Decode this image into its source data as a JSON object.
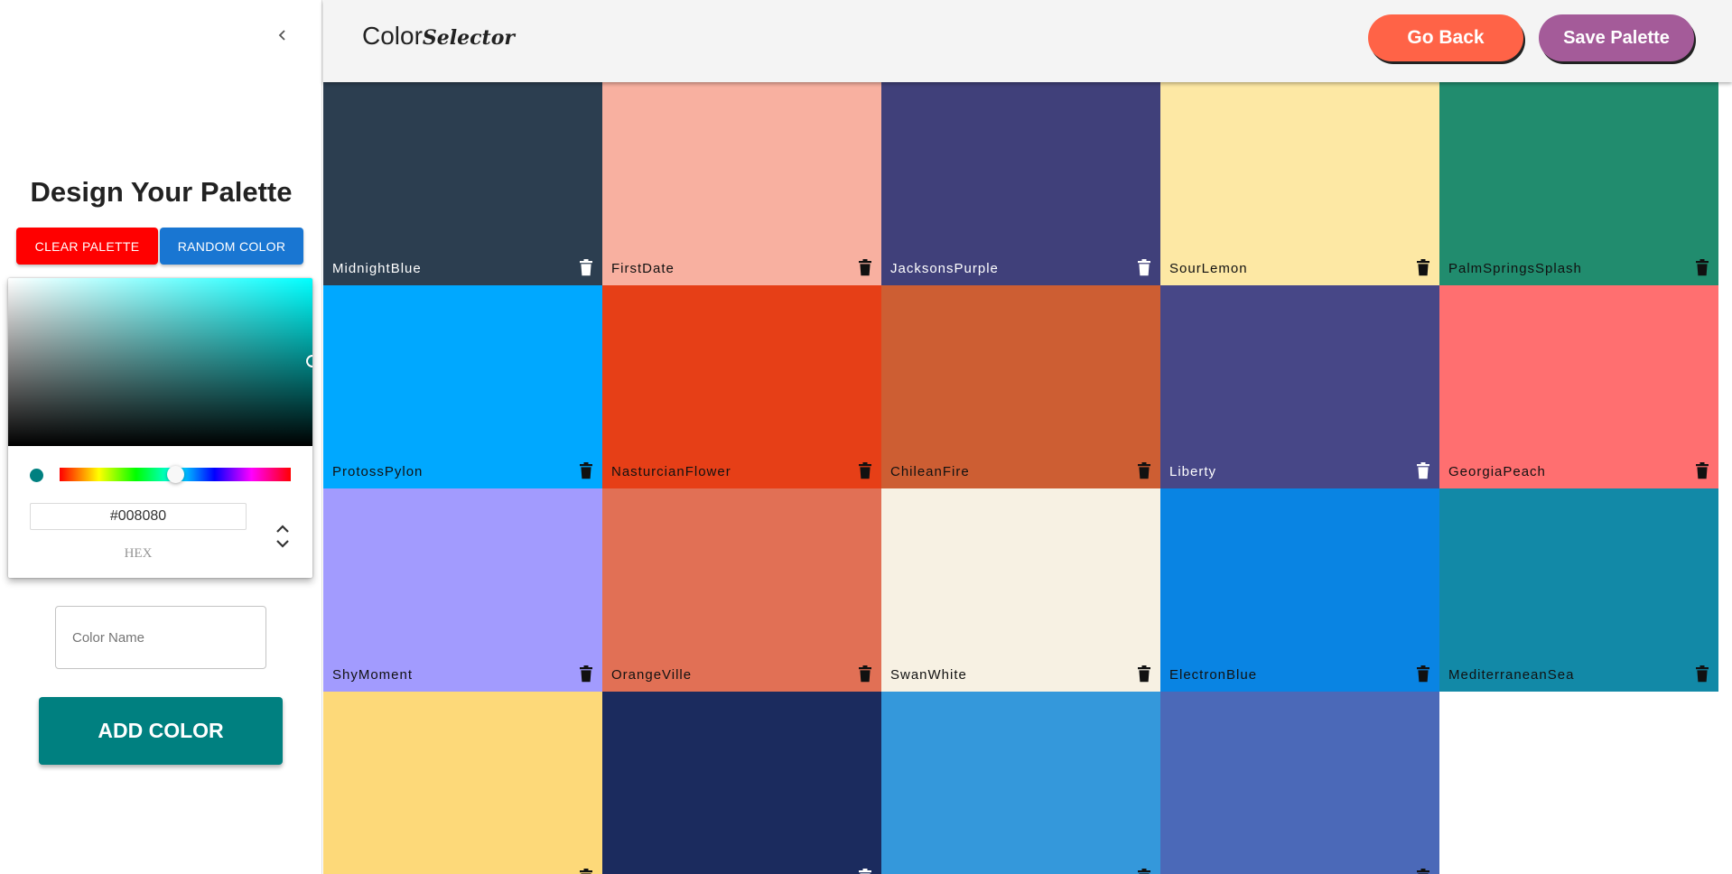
{
  "sidebar": {
    "title": "Design Your Palette",
    "clear_label": "CLEAR PALETTE",
    "random_label": "RANDOM COLOR",
    "picker": {
      "current_color": "#008080",
      "hex_value": "#008080",
      "mode_label": "HEX",
      "hue_color": "#00ffff"
    },
    "name_placeholder": "Color Name",
    "add_label": "ADD COLOR",
    "add_color": "#008080"
  },
  "header": {
    "logo_a": "Color",
    "logo_b": "Selector",
    "back_label": "Go Back",
    "save_label": "Save Palette"
  },
  "palette": [
    {
      "name": "MidnightBlue",
      "color": "#2c3e50",
      "text": "light"
    },
    {
      "name": "FirstDate",
      "color": "#f8b0a0",
      "text": "dark"
    },
    {
      "name": "JacksonsPurple",
      "color": "#40407a",
      "text": "light"
    },
    {
      "name": "SourLemon",
      "color": "#fde8a4",
      "text": "dark"
    },
    {
      "name": "PalmSpringsSplash",
      "color": "#218c6e",
      "text": "dark"
    },
    {
      "name": "ProtossPylon",
      "color": "#00a8ff",
      "text": "dark"
    },
    {
      "name": "NasturcianFlower",
      "color": "#e63f17",
      "text": "dark"
    },
    {
      "name": "ChileanFire",
      "color": "#cd5e33",
      "text": "dark"
    },
    {
      "name": "Liberty",
      "color": "#474787",
      "text": "light"
    },
    {
      "name": "GeorgiaPeach",
      "color": "#ff6f70",
      "text": "dark"
    },
    {
      "name": "ShyMoment",
      "color": "#a29bfe",
      "text": "dark"
    },
    {
      "name": "OrangeVille",
      "color": "#e17055",
      "text": "dark"
    },
    {
      "name": "SwanWhite",
      "color": "#f7f1e3",
      "text": "dark"
    },
    {
      "name": "ElectronBlue",
      "color": "#0984e3",
      "text": "dark"
    },
    {
      "name": "MediterraneanSea",
      "color": "#1289a7",
      "text": "dark"
    },
    {
      "name": "",
      "color": "#fdd979",
      "text": "dark"
    },
    {
      "name": "",
      "color": "#1b2b5e",
      "text": "light"
    },
    {
      "name": "",
      "color": "#3498db",
      "text": "dark"
    },
    {
      "name": "",
      "color": "#4b69b8",
      "text": "dark"
    }
  ]
}
